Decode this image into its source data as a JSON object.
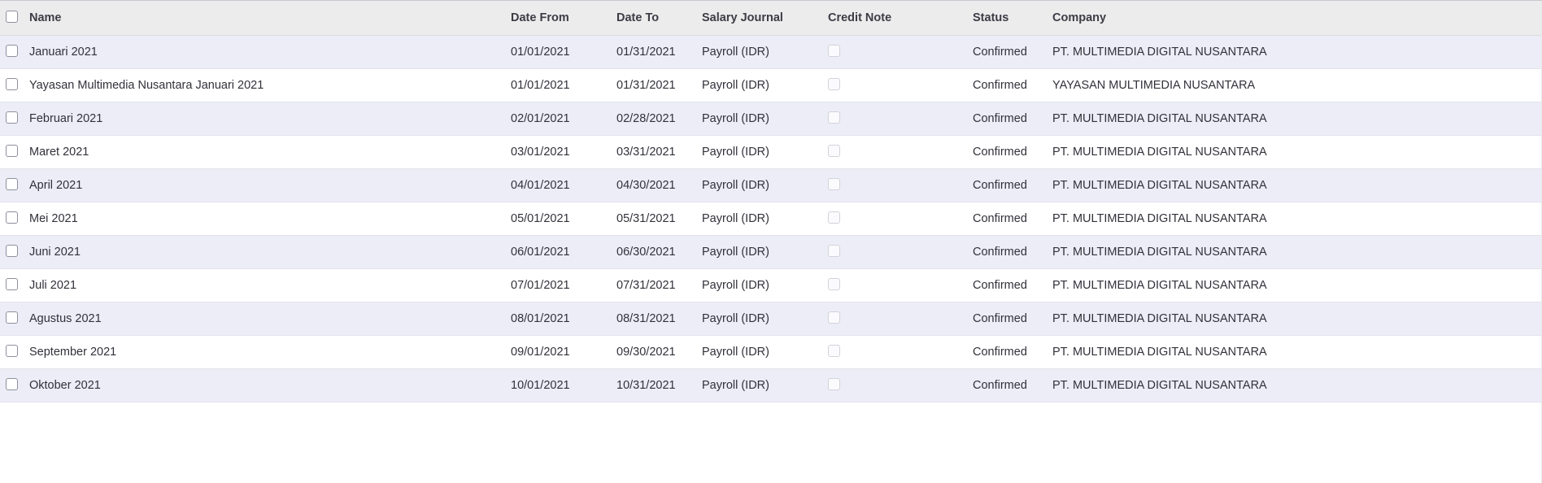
{
  "table": {
    "select_all_checkbox": "select-all",
    "columns": [
      {
        "key": "select",
        "label": ""
      },
      {
        "key": "name",
        "label": "Name"
      },
      {
        "key": "date_from",
        "label": "Date From"
      },
      {
        "key": "date_to",
        "label": "Date To"
      },
      {
        "key": "salary_journal",
        "label": "Salary Journal"
      },
      {
        "key": "credit_note",
        "label": "Credit Note"
      },
      {
        "key": "status",
        "label": "Status"
      },
      {
        "key": "company",
        "label": "Company"
      }
    ],
    "rows": [
      {
        "name": "Januari 2021",
        "date_from": "01/01/2021",
        "date_to": "01/31/2021",
        "salary_journal": "Payroll (IDR)",
        "credit_note": false,
        "status": "Confirmed",
        "company": "PT. MULTIMEDIA DIGITAL NUSANTARA"
      },
      {
        "name": "Yayasan Multimedia Nusantara Januari 2021",
        "date_from": "01/01/2021",
        "date_to": "01/31/2021",
        "salary_journal": "Payroll (IDR)",
        "credit_note": false,
        "status": "Confirmed",
        "company": "YAYASAN MULTIMEDIA NUSANTARA"
      },
      {
        "name": "Februari 2021",
        "date_from": "02/01/2021",
        "date_to": "02/28/2021",
        "salary_journal": "Payroll (IDR)",
        "credit_note": false,
        "status": "Confirmed",
        "company": "PT. MULTIMEDIA DIGITAL NUSANTARA"
      },
      {
        "name": "Maret 2021",
        "date_from": "03/01/2021",
        "date_to": "03/31/2021",
        "salary_journal": "Payroll (IDR)",
        "credit_note": false,
        "status": "Confirmed",
        "company": "PT. MULTIMEDIA DIGITAL NUSANTARA"
      },
      {
        "name": "April 2021",
        "date_from": "04/01/2021",
        "date_to": "04/30/2021",
        "salary_journal": "Payroll (IDR)",
        "credit_note": false,
        "status": "Confirmed",
        "company": "PT. MULTIMEDIA DIGITAL NUSANTARA"
      },
      {
        "name": "Mei 2021",
        "date_from": "05/01/2021",
        "date_to": "05/31/2021",
        "salary_journal": "Payroll (IDR)",
        "credit_note": false,
        "status": "Confirmed",
        "company": "PT. MULTIMEDIA DIGITAL NUSANTARA"
      },
      {
        "name": "Juni 2021",
        "date_from": "06/01/2021",
        "date_to": "06/30/2021",
        "salary_journal": "Payroll (IDR)",
        "credit_note": false,
        "status": "Confirmed",
        "company": "PT. MULTIMEDIA DIGITAL NUSANTARA"
      },
      {
        "name": "Juli 2021",
        "date_from": "07/01/2021",
        "date_to": "07/31/2021",
        "salary_journal": "Payroll (IDR)",
        "credit_note": false,
        "status": "Confirmed",
        "company": "PT. MULTIMEDIA DIGITAL NUSANTARA"
      },
      {
        "name": "Agustus 2021",
        "date_from": "08/01/2021",
        "date_to": "08/31/2021",
        "salary_journal": "Payroll (IDR)",
        "credit_note": false,
        "status": "Confirmed",
        "company": "PT. MULTIMEDIA DIGITAL NUSANTARA"
      },
      {
        "name": "September 2021",
        "date_from": "09/01/2021",
        "date_to": "09/30/2021",
        "salary_journal": "Payroll (IDR)",
        "credit_note": false,
        "status": "Confirmed",
        "company": "PT. MULTIMEDIA DIGITAL NUSANTARA"
      },
      {
        "name": "Oktober 2021",
        "date_from": "10/01/2021",
        "date_to": "10/31/2021",
        "salary_journal": "Payroll (IDR)",
        "credit_note": false,
        "status": "Confirmed",
        "company": "PT. MULTIMEDIA DIGITAL NUSANTARA"
      }
    ]
  },
  "colors": {
    "header_background": "#ececec",
    "row_striped_background": "#ecedf7",
    "row_background": "#ffffff",
    "row_border": "#e3e3ea",
    "text": "#31313a"
  }
}
